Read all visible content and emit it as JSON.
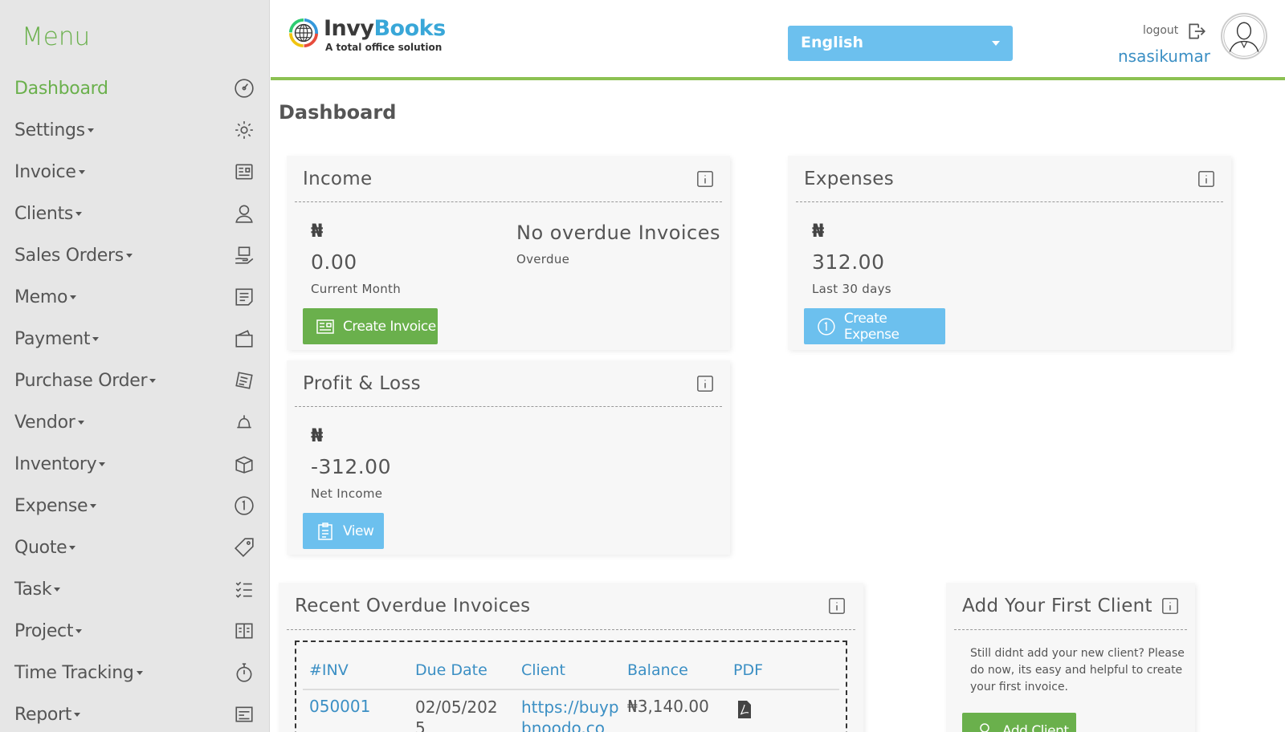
{
  "sidebar": {
    "title": "Menu",
    "items": [
      {
        "label": "Dashboard",
        "icon": "dashboard-gauge-icon",
        "caret": false,
        "active": true
      },
      {
        "label": "Settings",
        "icon": "gear-icon",
        "caret": true
      },
      {
        "label": "Invoice",
        "icon": "invoice-icon",
        "caret": true
      },
      {
        "label": "Clients",
        "icon": "user-icon",
        "caret": true
      },
      {
        "label": "Sales Orders",
        "icon": "sales-hand-icon",
        "caret": true
      },
      {
        "label": "Memo",
        "icon": "memo-icon",
        "caret": true
      },
      {
        "label": "Payment",
        "icon": "wallet-icon",
        "caret": true
      },
      {
        "label": "Purchase Order",
        "icon": "purchase-order-icon",
        "caret": true
      },
      {
        "label": "Vendor",
        "icon": "vendor-bell-icon",
        "caret": true
      },
      {
        "label": "Inventory",
        "icon": "box-icon",
        "caret": true
      },
      {
        "label": "Expense",
        "icon": "coin-icon",
        "caret": true
      },
      {
        "label": "Quote",
        "icon": "tag-icon",
        "caret": true
      },
      {
        "label": "Task",
        "icon": "checklist-icon",
        "caret": true
      },
      {
        "label": "Project",
        "icon": "project-icon",
        "caret": true
      },
      {
        "label": "Time Tracking",
        "icon": "stopwatch-icon",
        "caret": true
      },
      {
        "label": "Report",
        "icon": "report-icon",
        "caret": true
      }
    ]
  },
  "header": {
    "logo_name_a": "Invy",
    "logo_name_b": "Books",
    "logo_tagline": "A total office solution",
    "language": "English",
    "logout_label": "logout",
    "username": "nsasikumar"
  },
  "page": {
    "title": "Dashboard"
  },
  "income": {
    "title": "Income",
    "currency": "₦",
    "value": "0.00",
    "value_label": "Current Month",
    "overdue_text": "No overdue Invoices",
    "overdue_label": "Overdue",
    "button": "Create Invoice"
  },
  "expenses": {
    "title": "Expenses",
    "currency": "₦",
    "value": "312.00",
    "value_label": "Last 30 days",
    "button": "Create Expense"
  },
  "profit_loss": {
    "title": "Profit & Loss",
    "currency": "₦",
    "value": "-312.00",
    "value_label": "Net Income",
    "button": "View"
  },
  "overdue_invoices": {
    "title": "Recent Overdue Invoices",
    "columns": [
      "#INV",
      "Due Date",
      "Client",
      "Balance",
      "PDF"
    ],
    "rows": [
      {
        "inv": "050001",
        "due_date_1": "02/05/202",
        "due_date_2": "5",
        "client_1": "https://buyp",
        "client_2": "bnoodo.co",
        "balance": "₦3,140.00"
      }
    ]
  },
  "first_client": {
    "title": "Add Your First Client",
    "text": "Still didnt add your new client? Please do now, its easy and helpful to create your first invoice.",
    "button": "Add Client"
  },
  "colors": {
    "green": "#6ab04c",
    "blue": "#6cc0ee",
    "link": "#3b8fc4"
  }
}
